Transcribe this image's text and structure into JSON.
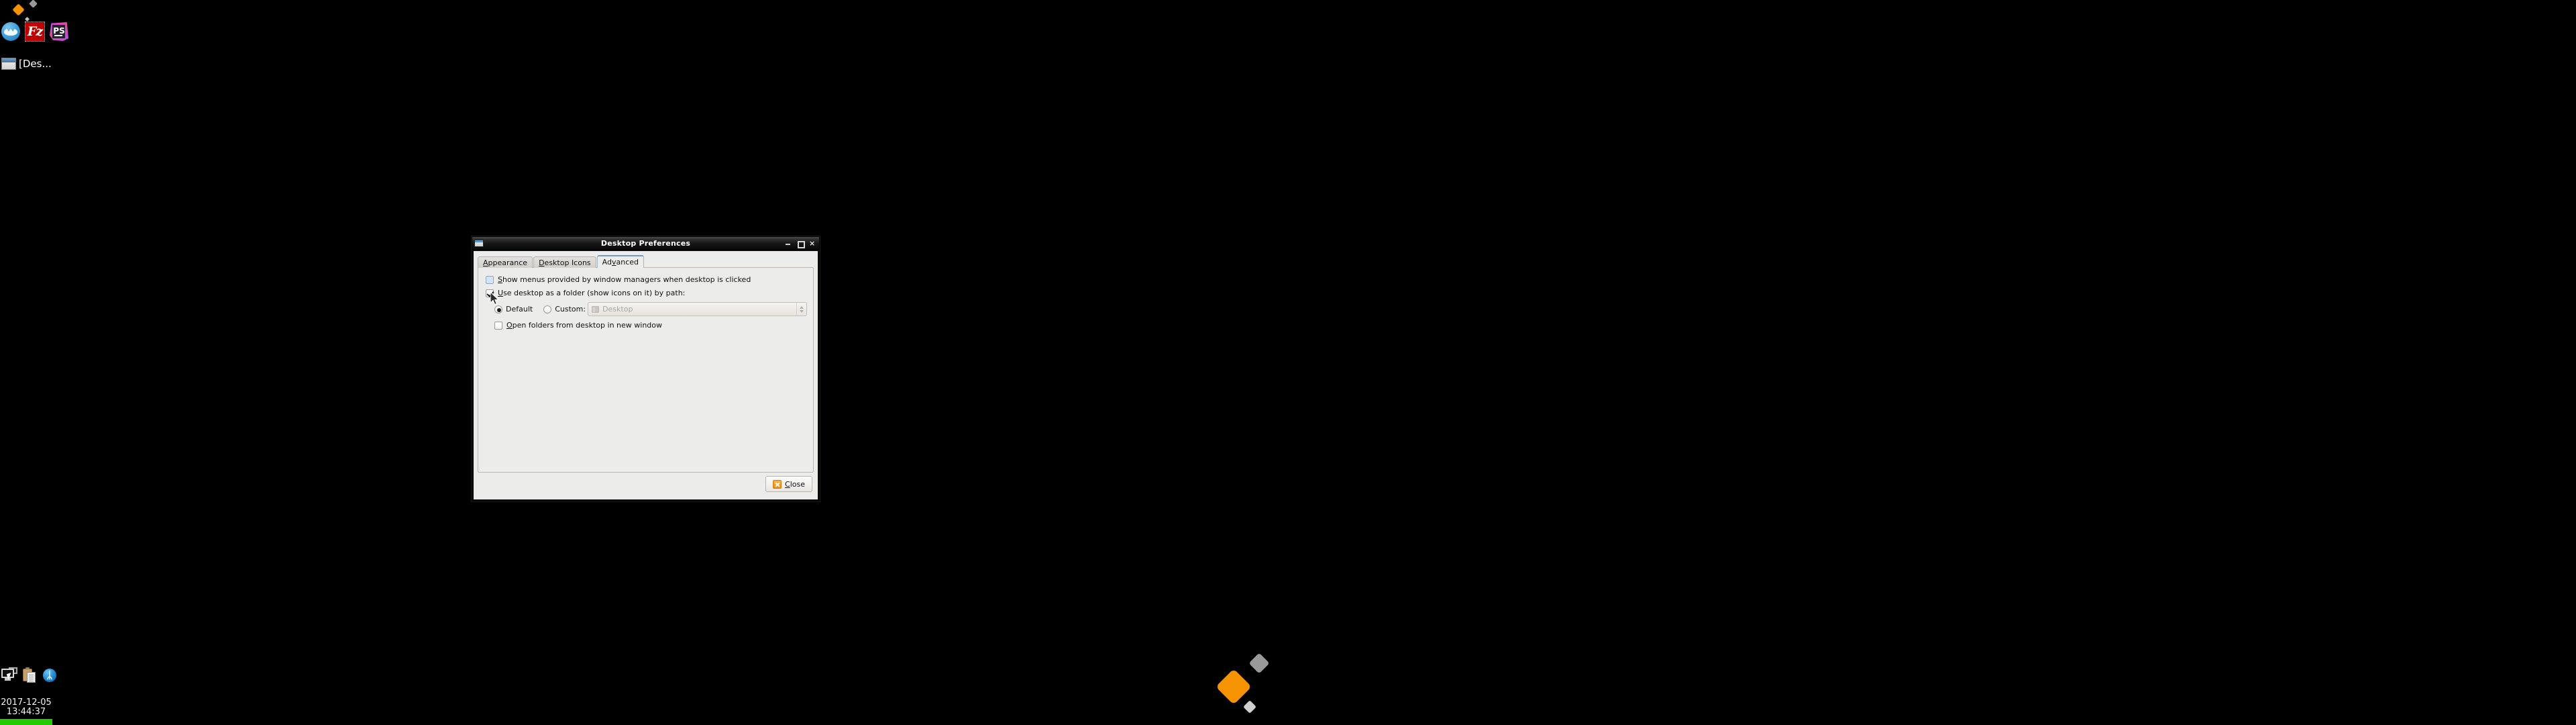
{
  "desktop": {
    "icons": [
      {
        "name": "web-browser-icon",
        "label": ""
      },
      {
        "name": "filezilla-icon",
        "label": "Fz"
      },
      {
        "name": "phpstorm-icon",
        "label": "PS"
      }
    ],
    "taskbar_window": {
      "label": "[Des...",
      "icon": "window-icon"
    },
    "tray": [
      {
        "name": "display-settings-icon"
      },
      {
        "name": "clipboard-manager-icon"
      },
      {
        "name": "bluetooth-icon",
        "glyph": "ᛦ"
      }
    ],
    "clock": {
      "date": "2017-12-05",
      "time": "13:44:37"
    }
  },
  "dialog": {
    "title": "Desktop Preferences",
    "window_icon": "window-icon",
    "controls": {
      "minimize": "–",
      "maximize": "□",
      "close": "×"
    },
    "tabs": [
      {
        "label_pre": "",
        "label_mnemonic": "A",
        "label_post": "ppearance",
        "active": false
      },
      {
        "label_pre": "",
        "label_mnemonic": "D",
        "label_post": "esktop Icons",
        "active": false
      },
      {
        "label_pre": "Ad",
        "label_mnemonic": "v",
        "label_post": "anced",
        "active": true
      }
    ],
    "advanced": {
      "show_menus": {
        "label_pre": "",
        "label_mnemonic": "S",
        "label_post": "how menus provided by window managers when desktop is clicked",
        "checked": false
      },
      "use_desktop_folder": {
        "label_pre": "",
        "label_mnemonic": "U",
        "label_post": "se desktop as a folder (show icons on it) by path:",
        "checked": true
      },
      "path_default": {
        "label": "Default",
        "selected": true
      },
      "path_custom": {
        "label": "Custom:",
        "selected": false
      },
      "path_value": "Desktop",
      "path_icon": "folder-icon",
      "open_new_window": {
        "label_pre": "",
        "label_mnemonic": "O",
        "label_post": "pen folders from desktop in new window",
        "checked": false
      }
    },
    "footer": {
      "close_label_pre": "",
      "close_label_mnemonic": "C",
      "close_label_post": "lose",
      "close_icon": "close-x-icon"
    }
  },
  "colors": {
    "accent_orange": "#f59400",
    "tray_green": "#22cc00",
    "tab_active_border": "#6f9bc4",
    "dialog_bg": "#ececeb",
    "desktop_bg": "#000000"
  }
}
